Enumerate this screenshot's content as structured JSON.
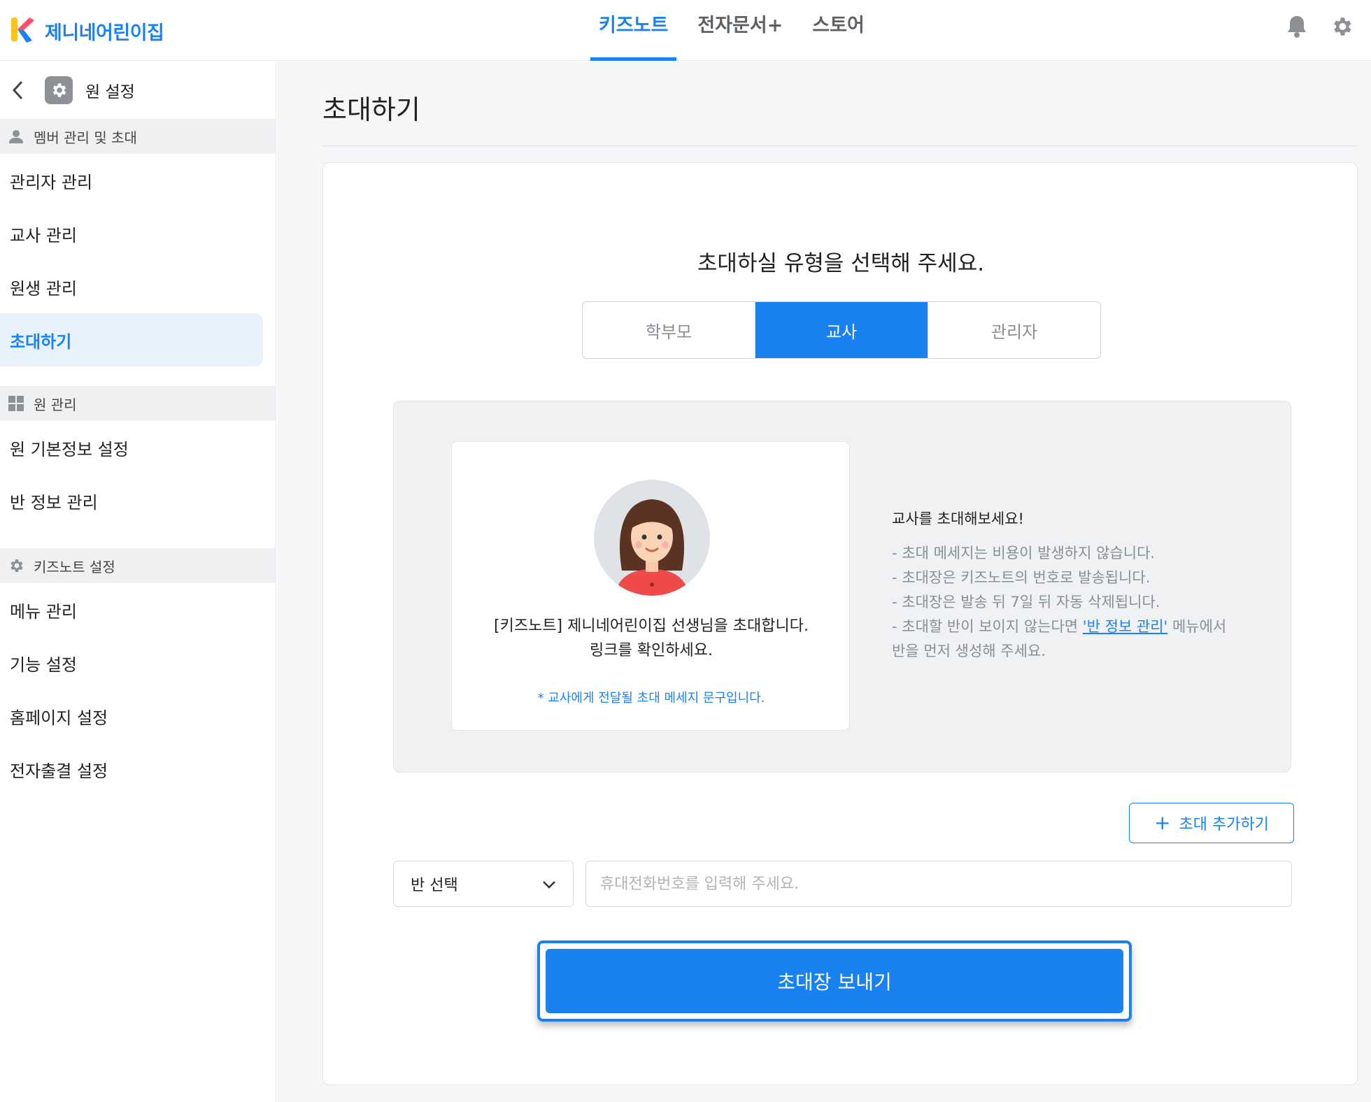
{
  "brand": {
    "name": "제니네어린이집"
  },
  "top_nav": {
    "tabs": [
      {
        "label": "키즈노트",
        "active": true
      },
      {
        "label": "전자문서+"
      },
      {
        "label": "스토어"
      }
    ]
  },
  "sidebar": {
    "header": "원 설정",
    "sections": [
      {
        "title": "멤버 관리 및 초대",
        "icon": "person-icon",
        "items": [
          {
            "label": "관리자 관리"
          },
          {
            "label": "교사 관리"
          },
          {
            "label": "원생 관리"
          },
          {
            "label": "초대하기",
            "active": true
          }
        ]
      },
      {
        "title": "원 관리",
        "icon": "grid-icon",
        "items": [
          {
            "label": "원 기본정보 설정"
          },
          {
            "label": "반 정보 관리"
          }
        ]
      },
      {
        "title": "키즈노트 설정",
        "icon": "gear-icon",
        "items": [
          {
            "label": "메뉴 관리"
          },
          {
            "label": "기능 설정"
          },
          {
            "label": "홈페이지 설정"
          },
          {
            "label": "전자출결 설정"
          }
        ]
      }
    ]
  },
  "main": {
    "title": "초대하기",
    "prompt": "초대하실 유형을 선택해 주세요.",
    "types": [
      {
        "label": "학부모"
      },
      {
        "label": "교사",
        "active": true
      },
      {
        "label": "관리자"
      }
    ],
    "message": {
      "line1": "[키즈노트] 제니네어린이집 선생님을 초대합니다.",
      "line2": "링크를 확인하세요.",
      "note": "* 교사에게 전달될 초대 메세지 문구입니다."
    },
    "info": {
      "title": "교사를 초대해보세요!",
      "lines": [
        "- 초대 메세지는 비용이 발생하지 않습니다.",
        "- 초대장은 키즈노트의 번호로 발송됩니다.",
        "- 초대장은 발송 뒤 7일 뒤 자동 삭제됩니다."
      ],
      "last_prefix": "- 초대할 반이 보이지 않는다면 ",
      "last_link": "'반 정보 관리'",
      "last_suffix": " 메뉴에서 반을 먼저 생성해 주세요."
    },
    "add_button": "초대 추가하기",
    "class_select": "반 선택",
    "phone_placeholder": "휴대전화번호를 입력해 주세요.",
    "send_button": "초대장 보내기"
  },
  "colors": {
    "accent": "#1a82f0",
    "sidebar_section_bg": "#eef0f2",
    "active_item_bg": "#e8f2fd"
  }
}
